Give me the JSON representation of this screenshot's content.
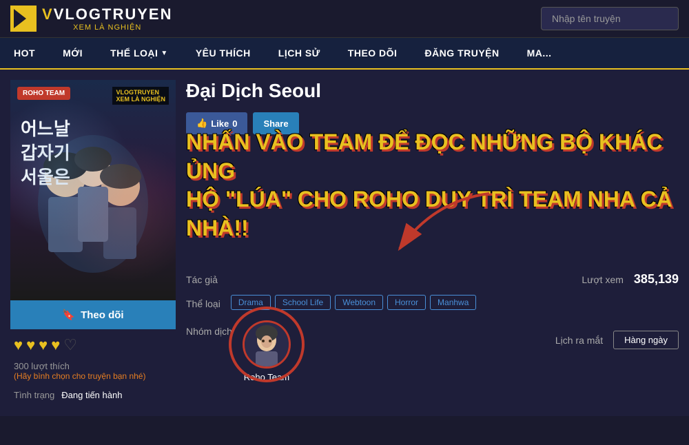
{
  "header": {
    "logo_main": "VLOGTRUYEN",
    "logo_sub": "XEM LÀ NGHIỆN",
    "logo_v": "V",
    "search_placeholder": "Nhập tên truyện"
  },
  "nav": {
    "items": [
      {
        "label": "HOT",
        "id": "hot"
      },
      {
        "label": "MỚI",
        "id": "moi"
      },
      {
        "label": "THỂ LOẠI",
        "id": "the-loai",
        "has_arrow": true
      },
      {
        "label": "YÊU THÍCH",
        "id": "yeu-thich"
      },
      {
        "label": "LỊCH SỬ",
        "id": "lich-su"
      },
      {
        "label": "THEO DÕI",
        "id": "theo-doi"
      },
      {
        "label": "ĐĂNG TRUYỆN",
        "id": "dang-truyen"
      },
      {
        "label": "MA...",
        "id": "ma"
      }
    ]
  },
  "manga": {
    "title": "Đại Dịch Seoul",
    "cover_title": "어느날 갑자기 서울은",
    "roho_badge": "ROHO TEAM",
    "watermark": "VLOGTRUYEN\nXEM LÀ NGHIỆN",
    "author_label": "Tác giả",
    "author_value": "",
    "views_label": "Lượt xem",
    "views_value": "385,139",
    "genre_label": "Thể loại",
    "genres": [
      "Drama",
      "School Life",
      "Webtoon",
      "Horror",
      "Manhwa"
    ],
    "translator_label": "Nhóm dịch",
    "translator_name": "Roho Team",
    "schedule_label": "Lịch ra mắt",
    "schedule_value": "Hàng ngày",
    "like_btn": "Like",
    "like_count": "0",
    "share_btn": "Share",
    "follow_btn": "Theo dõi",
    "hearts_filled": 4,
    "hearts_total": 5,
    "like_count_display": "300 lượt thích",
    "vote_hint": "(Hãy bình chọn cho truyện bạn nhé)",
    "status_label": "Tình trạng",
    "status_value": "Đang tiến hành",
    "promo_line1": "NHẤN VÀO TEAM ĐỂ ĐỌC NHỮNG BỘ KHÁC ỦNG",
    "promo_line2": "HỘ \"LÚA\" CHO ROHO DUY TRÌ TEAM NHA CẢ NHÀ!!"
  },
  "icons": {
    "bookmark": "🔖",
    "heart_filled": "♥",
    "heart_empty": "♡",
    "thumb_up": "👍",
    "chevron_down": "▼"
  }
}
